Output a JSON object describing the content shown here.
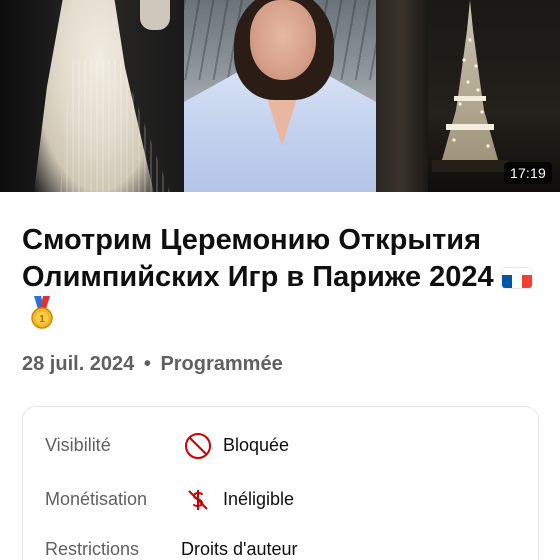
{
  "video": {
    "duration": "17:19",
    "title": "Смотрим Церемонию Открытия Олимпийских Игр в Париже 2024",
    "title_emoji": [
      "flag-france",
      "sports-medal"
    ],
    "date": "28 juil. 2024",
    "separator": "•",
    "status": "Programmée"
  },
  "details": {
    "rows": [
      {
        "label": "Visibilité",
        "icon": "blocked-icon",
        "value": "Bloquée",
        "icon_color": "#cc0000"
      },
      {
        "label": "Monétisation",
        "icon": "no-dollar-icon",
        "value": "Inéligible",
        "icon_color": "#cc0000"
      },
      {
        "label": "Restrictions",
        "value": "Droits d'auteur"
      }
    ]
  },
  "colors": {
    "flag_blue": "#0055a4",
    "flag_white": "#ffffff",
    "flag_red": "#ef4135",
    "medal_gold": "#f2b824"
  }
}
